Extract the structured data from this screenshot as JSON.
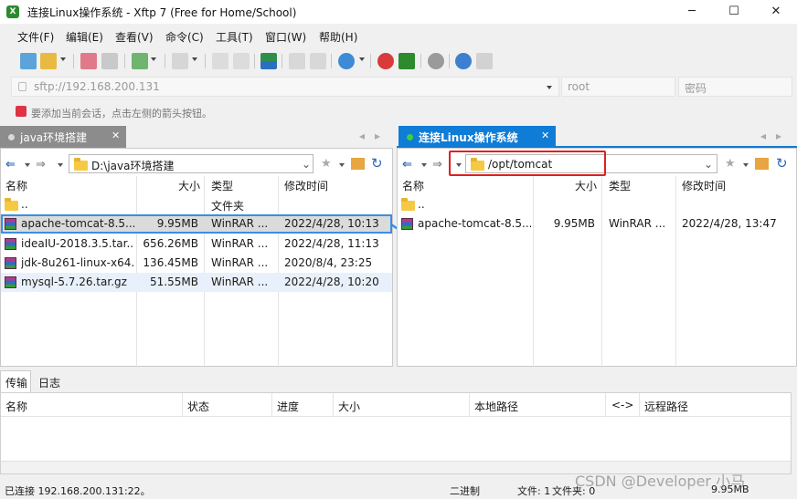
{
  "window": {
    "title": "连接Linux操作系统 - Xftp 7 (Free for Home/School)",
    "minimize": "─",
    "maximize": "☐",
    "close": "✕"
  },
  "menu": [
    "文件(F)",
    "编辑(E)",
    "查看(V)",
    "命令(C)",
    "工具(T)",
    "窗口(W)",
    "帮助(H)"
  ],
  "address": {
    "url": "sftp://192.168.200.131",
    "user_placeholder": "root",
    "password_placeholder": "密码"
  },
  "hint": "要添加当前会话，点击左侧的箭头按钮。",
  "left_pane": {
    "tab": "java环境搭建",
    "path": "D:\\java环境搭建",
    "columns": [
      "名称",
      "大小",
      "类型",
      "修改时间"
    ],
    "rows": [
      {
        "name": "..",
        "size": "",
        "type": "文件夹",
        "modified": "",
        "icon": "folder-icon"
      },
      {
        "name": "apache-tomcat-8.5....",
        "size": "9.95MB",
        "type": "WinRAR ...",
        "modified": "2022/4/28, 10:13",
        "icon": "rar-icon",
        "selected": true
      },
      {
        "name": "ideaIU-2018.3.5.tar....",
        "size": "656.26MB",
        "type": "WinRAR ...",
        "modified": "2022/4/28, 11:13",
        "icon": "rar-icon"
      },
      {
        "name": "jdk-8u261-linux-x64...",
        "size": "136.45MB",
        "type": "WinRAR ...",
        "modified": "2020/8/4, 23:25",
        "icon": "rar-icon"
      },
      {
        "name": "mysql-5.7.26.tar.gz",
        "size": "51.55MB",
        "type": "WinRAR ...",
        "modified": "2022/4/28, 10:20",
        "icon": "rar-icon"
      }
    ]
  },
  "right_pane": {
    "tab": "连接Linux操作系统",
    "path": "/opt/tomcat",
    "columns": [
      "名称",
      "大小",
      "类型",
      "修改时间"
    ],
    "rows": [
      {
        "name": "..",
        "size": "",
        "type": "",
        "modified": "",
        "icon": "folder-icon"
      },
      {
        "name": "apache-tomcat-8.5....",
        "size": "9.95MB",
        "type": "WinRAR ...",
        "modified": "2022/4/28, 13:47",
        "icon": "rar-icon"
      }
    ]
  },
  "transfer": {
    "tabs": [
      "传输",
      "日志"
    ],
    "columns": [
      "名称",
      "状态",
      "进度",
      "大小",
      "本地路径",
      "<->",
      "远程路径"
    ]
  },
  "status": {
    "connection": "已连接 192.168.200.131:22。",
    "mode": "二进制",
    "files": "文件: 1",
    "folders": "文件夹: 0",
    "size": "9.95MB"
  },
  "watermark": "CSDN @Developer 小马",
  "colors": {
    "active_tab": "#0f7cd6",
    "inactive_tab": "#8a8a8a",
    "highlight_box": "#e02020",
    "selection_outline": "#3a8ee6"
  }
}
